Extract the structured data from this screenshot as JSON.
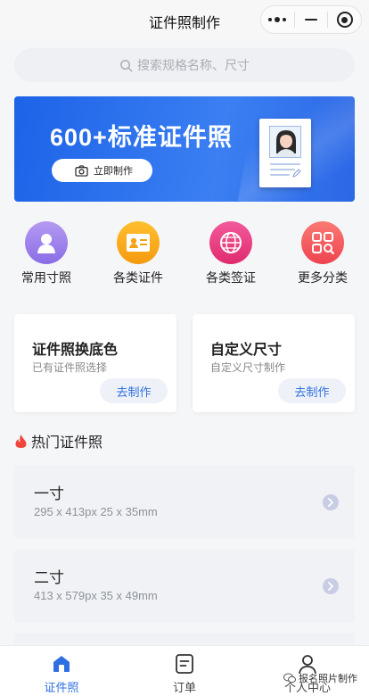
{
  "topbar": {
    "title": "证件照制作"
  },
  "search": {
    "placeholder": "搜索规格名称、尺寸"
  },
  "banner": {
    "headline": "600+标准证件照",
    "cta": "立即制作"
  },
  "categories": [
    {
      "label": "常用寸照",
      "icon": "person-icon",
      "color": "#9b7bea"
    },
    {
      "label": "各类证件",
      "icon": "id-card-icon",
      "color": "#f7a31a"
    },
    {
      "label": "各类签证",
      "icon": "passport-icon",
      "color": "#ec3a82"
    },
    {
      "label": "更多分类",
      "icon": "grid-search-icon",
      "color": "#f2535f"
    }
  ],
  "cards": [
    {
      "title": "证件照换底色",
      "subtitle": "已有证件照选择",
      "button": "去制作"
    },
    {
      "title": "自定义尺寸",
      "subtitle": "自定义尺寸制作",
      "button": "去制作"
    }
  ],
  "hot": {
    "title": "热门证件照",
    "items": [
      {
        "name": "一寸",
        "detail": "295 x 413px  25 x 35mm"
      },
      {
        "name": "二寸",
        "detail": "413 x 579px  35 x 49mm"
      }
    ]
  },
  "tabbar": {
    "tabs": [
      {
        "label": "证件照",
        "active": true
      },
      {
        "label": "订单",
        "active": false
      },
      {
        "label": "个人中心",
        "active": false
      }
    ]
  },
  "watermark": "报名照片制作",
  "colors": {
    "accent": "#2f6fe0",
    "banner": "#1c63e8"
  }
}
